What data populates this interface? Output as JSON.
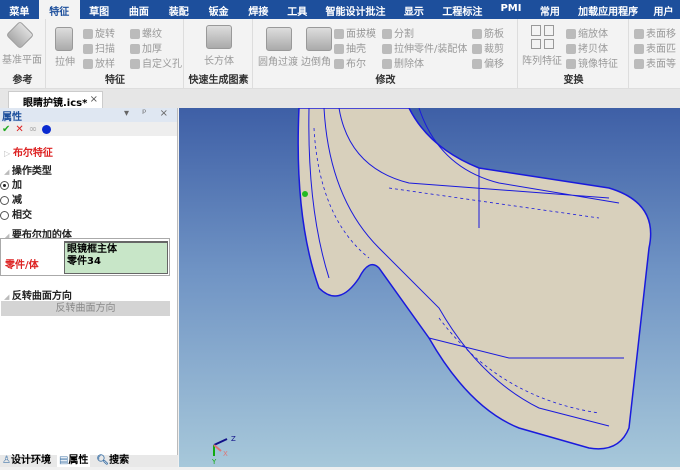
{
  "menu": [
    "菜单",
    "特征",
    "草图",
    "曲面",
    "装配",
    "钣金",
    "焊接",
    "工具",
    "智能设计批注",
    "显示",
    "工程标注",
    "PMI",
    "常用",
    "加载应用程序",
    "用户"
  ],
  "ribbon": {
    "ref": {
      "label": "参考",
      "items": [
        "基准平面"
      ]
    },
    "feature": {
      "label": "特征",
      "big": "拉伸",
      "items": [
        "旋转",
        "扫描",
        "放样",
        "螺纹",
        "加厚",
        "自定义孔"
      ]
    },
    "quick": {
      "label": "快速生成图素",
      "big": "长方体"
    },
    "modify": {
      "label": "修改",
      "big": [
        "圆角过渡",
        "边倒角"
      ],
      "items": [
        "面拔模",
        "抽壳",
        "布尔",
        "分割",
        "拉伸零件/装配体",
        "删除体",
        "筋板",
        "裁剪",
        "偏移"
      ]
    },
    "transform": {
      "label": "变换",
      "big": "阵列特征",
      "items": [
        "缩放体",
        "拷贝体",
        "镜像特征"
      ]
    },
    "surface": {
      "items": [
        "表面移",
        "表面匹",
        "表面等"
      ]
    }
  },
  "doc_tab": {
    "title": "眼睛护镜.ics*",
    "close": "×"
  },
  "panel": {
    "title": "属性",
    "controls": "▾ ᵖ ×",
    "feature_name": "布尔特征",
    "op_section": "操作类型",
    "ops": [
      {
        "label": "加",
        "selected": true
      },
      {
        "label": "减",
        "selected": false
      },
      {
        "label": "相交",
        "selected": false
      }
    ],
    "body_section": "要布尔加的体",
    "body_label": "零件/体",
    "bodies": [
      "眼镜框主体",
      "零件34"
    ],
    "flip_section": "反转曲面方向",
    "flip_button": "反转曲面方向"
  },
  "bottom_tabs": [
    "设计环境",
    "属性",
    "搜索"
  ],
  "axes": {
    "x": "X",
    "y": "Y",
    "z": "Z"
  },
  "colors": {
    "menubar": "#1d4f9c",
    "selection": "#c8e6c8",
    "accent_red": "#dd2222",
    "model_edge": "#1a1adc",
    "model_face": "#d8d0bc"
  }
}
